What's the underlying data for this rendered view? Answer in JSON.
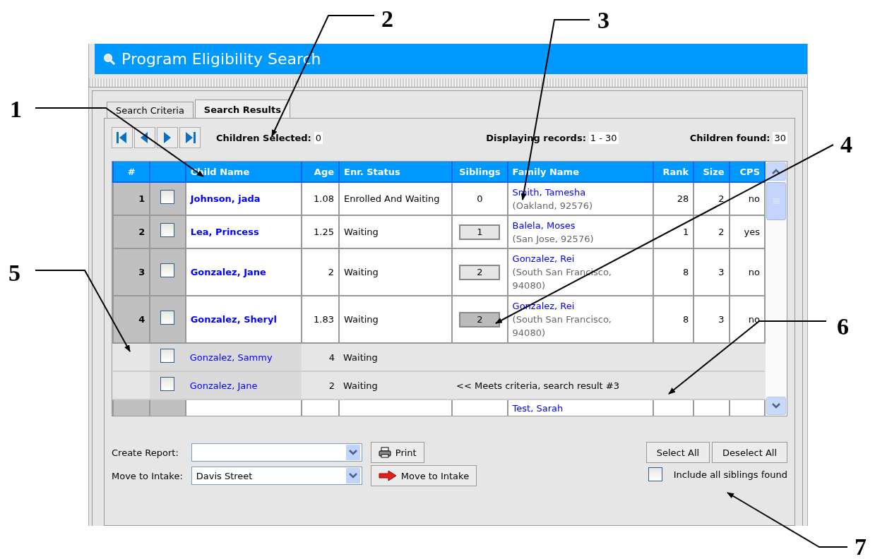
{
  "window": {
    "title": "Program Eligibility Search"
  },
  "tabs": [
    {
      "label": "Search Criteria",
      "selected": false
    },
    {
      "label": "Search Results",
      "selected": true
    }
  ],
  "toolbar": {
    "children_selected_label": "Children Selected:",
    "children_selected": "0",
    "displaying_label": "Displaying records:",
    "displaying": "1 - 30",
    "found_label": "Children found:",
    "found": "30"
  },
  "table": {
    "columns": [
      "#",
      "",
      "Child Name",
      "Age",
      "Enr. Status",
      "Siblings",
      "Family Name",
      "Rank",
      "Size",
      "CPS"
    ],
    "rows": [
      {
        "kind": "child",
        "num": "1",
        "checked": false,
        "name": "Johnson, jada",
        "age": "1.08",
        "status": "Enrolled And Waiting",
        "siblings": {
          "kind": "text",
          "value": "0"
        },
        "family": "Smith, Tamesha",
        "location": "(Oakland, 92576)",
        "rank": "28",
        "size": "2",
        "cps": "no"
      },
      {
        "kind": "child",
        "num": "2",
        "checked": false,
        "name": "Lea, Princess",
        "age": "1.25",
        "status": "Waiting",
        "siblings": {
          "kind": "button",
          "value": "1",
          "pressed": false
        },
        "family": "Balela, Moses",
        "location": "(San Jose, 92576)",
        "rank": "1",
        "size": "2",
        "cps": "yes"
      },
      {
        "kind": "child",
        "num": "3",
        "checked": false,
        "name": "Gonzalez, Jane",
        "age": "2",
        "status": "Waiting",
        "siblings": {
          "kind": "button",
          "value": "2",
          "pressed": false
        },
        "family": "Gonzalez, Rei",
        "location": "(South San Francisco, 94080)",
        "rank": "8",
        "size": "3",
        "cps": "no"
      },
      {
        "kind": "child",
        "num": "4",
        "checked": false,
        "name": "Gonzalez, Sheryl",
        "age": "1.83",
        "status": "Waiting",
        "siblings": {
          "kind": "button",
          "value": "2",
          "pressed": true
        },
        "family": "Gonzalez, Rei",
        "location": "(South San Francisco, 94080)",
        "rank": "8",
        "size": "3",
        "cps": "no"
      },
      {
        "kind": "sibling",
        "checked": false,
        "name": "Gonzalez, Sammy",
        "age": "4",
        "status": "Waiting"
      },
      {
        "kind": "sibling",
        "checked": false,
        "name": "Gonzalez, Jane",
        "age": "2",
        "status": "Waiting",
        "note": "<< Meets criteria, search result #3"
      },
      {
        "kind": "cut",
        "family": "Test, Sarah"
      }
    ]
  },
  "report": {
    "label": "Create Report:",
    "print": "Print"
  },
  "intake": {
    "label": "Move to Intake:",
    "value": "Davis Street",
    "button": "Move to Intake"
  },
  "select_all": "Select All",
  "deselect_all": "Deselect All",
  "include_siblings": {
    "label": "Include all siblings found",
    "checked": false
  },
  "callouts": [
    "1",
    "2",
    "3",
    "4",
    "5",
    "6",
    "7"
  ]
}
